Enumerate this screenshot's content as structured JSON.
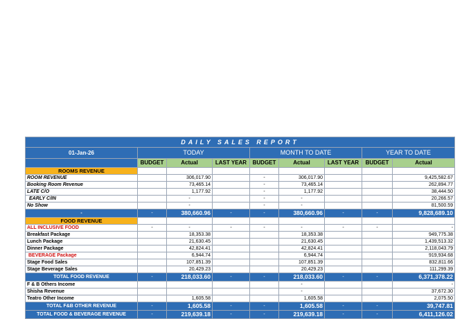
{
  "title": "DAILY SALES REPORT",
  "header": {
    "date": "01-Jan-26",
    "groups": [
      "TODAY",
      "MONTH TO DATE",
      "YEAR TO DATE"
    ],
    "cols": [
      "BUDGET",
      "Actual",
      "LAST YEAR"
    ],
    "ytd_cols": [
      "BUDGET",
      "Actual"
    ]
  },
  "rooms": {
    "section": "ROOMS REVENUE",
    "rows": [
      {
        "label": "ROOM REVENUE",
        "t_actual": "306,017.90",
        "m_budget": "-",
        "m_actual": "306,017.90",
        "y_actual": "9,425,582.67"
      },
      {
        "label": "Booking Room Revenue",
        "t_actual": "73,465.14",
        "m_budget": "-",
        "m_actual": "73,465.14",
        "y_actual": "262,894.77"
      },
      {
        "label": "LATE C/O",
        "t_actual": "1,177.92",
        "m_budget": "-",
        "m_actual": "1,177.92",
        "y_actual": "38,444.50"
      },
      {
        "label": "EARLY C/IN",
        "t_actual": "-",
        "m_budget": "-",
        "m_actual": "-",
        "y_actual": "20,266.57"
      },
      {
        "label": "No Show",
        "t_actual": "-",
        "m_budget": "-",
        "m_actual": "-",
        "y_actual": "81,500.59"
      }
    ],
    "total": {
      "label": "-",
      "t_budget": "-",
      "t_actual": "380,660.96",
      "t_ly": "-",
      "m_budget": "-",
      "m_actual": "380,660.96",
      "m_ly": "-",
      "y_budget": "-",
      "y_actual": "9,828,689.10"
    }
  },
  "food": {
    "section": "FOOD REVENUE",
    "all_inclusive": "ALL INCLUSIVE FOOD",
    "rows": [
      {
        "label": "Breakfast Package",
        "t_actual": "18,353.38",
        "m_actual": "18,353.38",
        "y_actual": "949,775.38"
      },
      {
        "label": "Lunch Package",
        "t_actual": "21,630.45",
        "m_actual": "21,630.45",
        "y_actual": "1,439,513.32"
      },
      {
        "label": "Dinner Package",
        "t_actual": "42,824.41",
        "m_actual": "42,824.41",
        "y_actual": "2,118,043.79"
      },
      {
        "label": "BEVERAGE Package",
        "t_actual": "6,944.74",
        "m_actual": "6,944.74",
        "y_actual": "919,934.68"
      },
      {
        "label": "Stage Food Sales",
        "t_actual": "107,851.39",
        "m_actual": "107,851.39",
        "y_actual": "832,811.66"
      },
      {
        "label": "Stage Beverage Sales",
        "t_actual": "20,429.23",
        "m_actual": "20,429.23",
        "y_actual": "111,299.39"
      }
    ],
    "total": {
      "label": "TOTAL FOOD REVENUE",
      "t_budget": "-",
      "t_actual": "218,033.60",
      "t_ly": "-",
      "m_budget": "-",
      "m_actual": "218,033.60",
      "m_ly": "-",
      "y_budget": "-",
      "y_actual": "6,371,378.22"
    }
  },
  "other": {
    "rows": [
      {
        "label": "F & B Others Income",
        "t_actual": "",
        "m_actual": "-",
        "y_actual": "-"
      },
      {
        "label": "Shisha Revenue",
        "t_actual": "",
        "m_actual": "-",
        "y_actual": "37,672.30"
      },
      {
        "label": "Teatro Other Income",
        "t_actual": "1,605.58",
        "m_actual": "1,605.58",
        "y_actual": "2,075.50"
      }
    ],
    "total": {
      "label": "TOTAL F&B OTHER REVENUE",
      "t_budget": "-",
      "t_actual": "1,605.58",
      "t_ly": "-",
      "m_budget": "-",
      "m_actual": "1,605.58",
      "m_ly": "-",
      "y_budget": "-",
      "y_actual": "39,747.81"
    }
  },
  "grand_total": {
    "label": "TOTAL FOOD & BEVERAGE REVENUE",
    "t_budget": "-",
    "t_actual": "219,639.18",
    "t_ly": "-",
    "m_budget": "-",
    "m_actual": "219,639.18",
    "m_ly": "-",
    "y_budget": "-",
    "y_actual": "6,411,126.02"
  }
}
